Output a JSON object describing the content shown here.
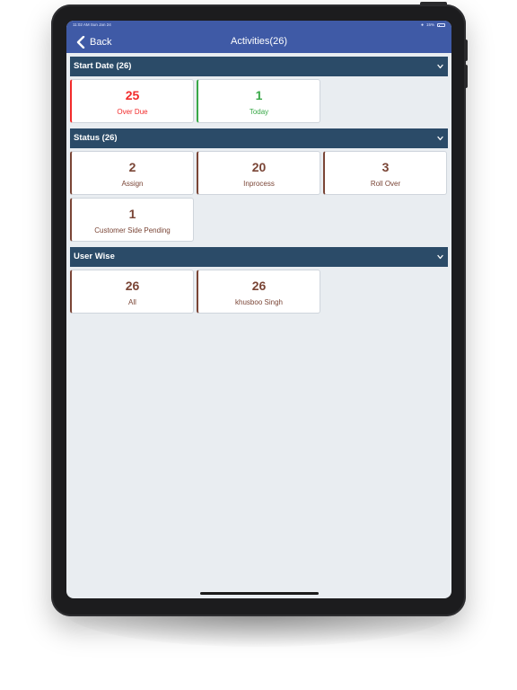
{
  "status_bar": {
    "time": "11:02 AM  Sun Jan 24",
    "battery": "15%"
  },
  "nav": {
    "back_label": "Back",
    "title": "Activities(26)"
  },
  "sections": [
    {
      "title": "Start Date (26)",
      "cards": [
        {
          "count": "25",
          "label": "Over Due",
          "color": "#f22b2b"
        },
        {
          "count": "1",
          "label": "Today",
          "color": "#38a847"
        }
      ]
    },
    {
      "title": "Status (26)",
      "cards": [
        {
          "count": "2",
          "label": "Assign",
          "color": "#7a4536"
        },
        {
          "count": "20",
          "label": "Inprocess",
          "color": "#7a4536"
        },
        {
          "count": "3",
          "label": "Roll Over",
          "color": "#7a4536"
        },
        {
          "count": "1",
          "label": "Customer Side Pending",
          "color": "#7a4536"
        }
      ]
    },
    {
      "title": "User Wise",
      "cards": [
        {
          "count": "26",
          "label": "All",
          "color": "#7a4536"
        },
        {
          "count": "26",
          "label": "khusboo Singh",
          "color": "#7a4536"
        }
      ]
    }
  ],
  "colors": {
    "nav_bar": "#3f5aa6",
    "section_header": "#2b4b68",
    "screen_background": "#e9edf1",
    "overdue": "#f22b2b",
    "today": "#38a847",
    "default_card": "#7a4536"
  }
}
